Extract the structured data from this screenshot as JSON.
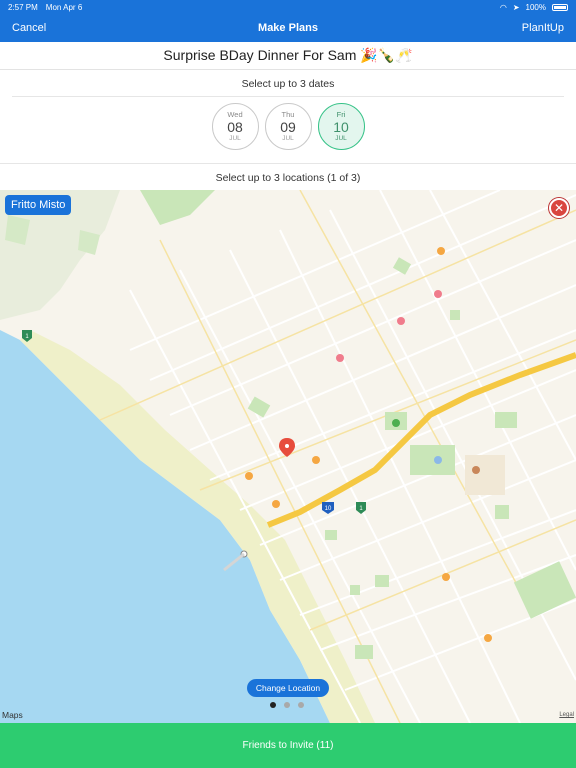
{
  "status_bar": {
    "time": "2:57 PM",
    "date": "Mon Apr 6",
    "battery": "100%"
  },
  "nav": {
    "cancel_label": "Cancel",
    "title": "Make Plans",
    "right_label": "PlanItUp"
  },
  "event": {
    "title": "Surprise BDay Dinner For Sam 🎉🍾🥂"
  },
  "dates_section": {
    "heading": "Select up to 3 dates",
    "dates": [
      {
        "dow": "Wed",
        "day": "08",
        "month": "JUL",
        "selected": false
      },
      {
        "dow": "Thu",
        "day": "09",
        "month": "JUL",
        "selected": false
      },
      {
        "dow": "Fri",
        "day": "10",
        "month": "JUL",
        "selected": true
      }
    ]
  },
  "locations_section": {
    "heading": "Select up to 3 locations (1 of 3)"
  },
  "map": {
    "place_label": "Fritto Misto",
    "change_location_label": "Change Location",
    "maps_logo": "Maps",
    "legal": "Legal",
    "route_shields": [
      "1",
      "10",
      "1"
    ],
    "page_count": 3,
    "active_page": 1
  },
  "colors": {
    "nav_blue": "#1a73d9",
    "invite_green": "#2dcc70",
    "selected_date": "#35c287",
    "water": "#a6d8f2",
    "park": "#c9e6b8",
    "highway": "#f5c842",
    "pin": "#e74c3c"
  },
  "footer": {
    "invite_label": "Friends to Invite (11)"
  }
}
